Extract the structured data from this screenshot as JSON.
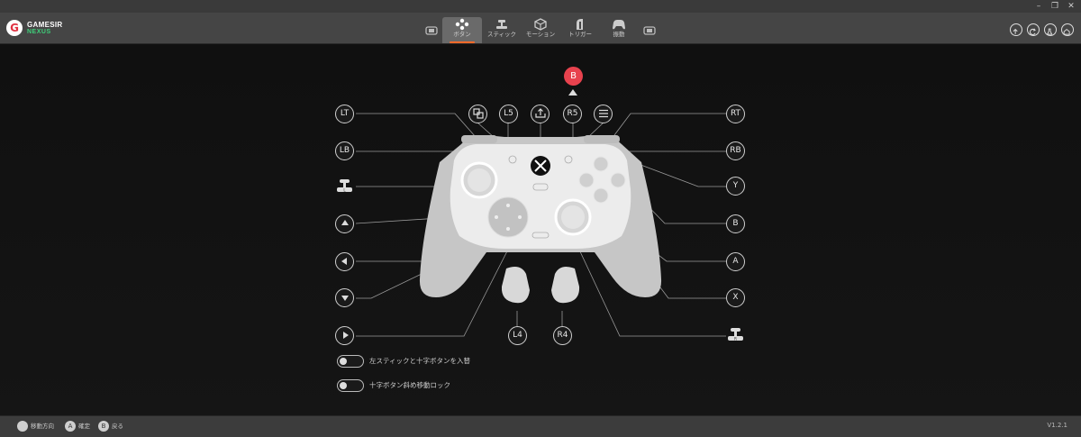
{
  "app": {
    "logo_text": "GAMESIR",
    "logo_sub": "NEXUS",
    "version": "V1.2.1"
  },
  "tabs": [
    {
      "id": "controller-select",
      "label": ""
    },
    {
      "id": "buttons",
      "label": "ボタン",
      "active": true
    },
    {
      "id": "stick",
      "label": "スティック"
    },
    {
      "id": "motion",
      "label": "モーション"
    },
    {
      "id": "trigger",
      "label": "トリガー"
    },
    {
      "id": "vibration",
      "label": "振動"
    },
    {
      "id": "profile",
      "label": ""
    }
  ],
  "mapping": {
    "active_indicator": "B",
    "left_callouts": [
      "LT",
      "LB",
      "",
      "",
      "",
      "",
      ""
    ],
    "top_callouts": [
      "",
      "L5",
      "",
      "R5",
      ""
    ],
    "right_callouts": [
      "RT",
      "RB",
      "Y",
      "B",
      "A",
      "X",
      ""
    ],
    "paddles": [
      "L4",
      "R4"
    ]
  },
  "options": [
    {
      "label": "左スティックと十字ボタンを入替",
      "on": false
    },
    {
      "label": "十字ボタン斜め移動ロック",
      "on": false
    }
  ],
  "footer": {
    "hints": [
      {
        "icon": "",
        "label": "移動方向"
      },
      {
        "icon": "A",
        "label": "確定"
      },
      {
        "icon": "B",
        "label": "戻る"
      }
    ]
  },
  "colors": {
    "accent": "#ff6a2a",
    "indicator": "#e8424e",
    "brand_green": "#3fd07a"
  }
}
